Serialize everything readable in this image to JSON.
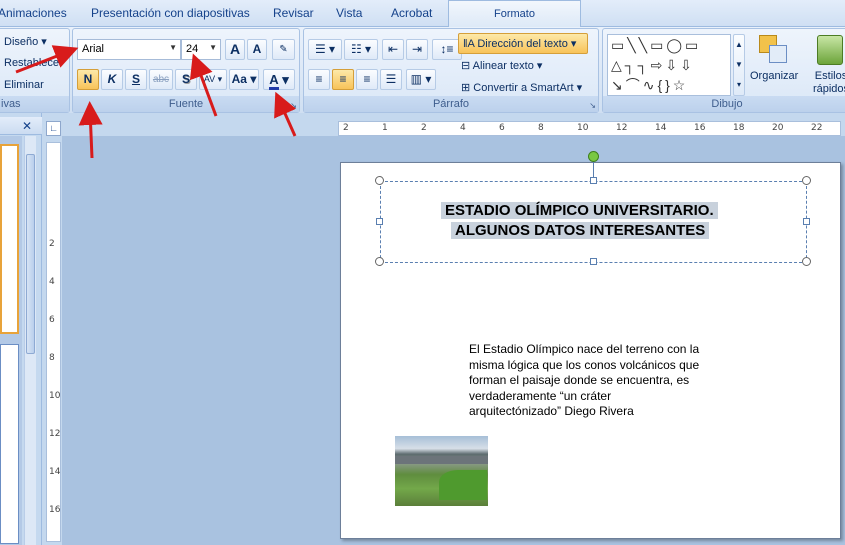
{
  "tabs": [
    "Animaciones",
    "Presentación con diapositivas",
    "Revisar",
    "Vista",
    "Acrobat",
    "Formato"
  ],
  "diapositivas_group": {
    "items": [
      "Diseño",
      "Restablecer",
      "Eliminar"
    ],
    "label_partial": "ivas"
  },
  "fuente_group": {
    "font_name": "Arial",
    "font_size": "24",
    "bold": "N",
    "italic": "K",
    "underline": "S",
    "strike": "abc",
    "shadow": "S",
    "spacing": "AV",
    "case": "Aa",
    "color": "A",
    "grow": "A",
    "shrink": "A",
    "label": "Fuente",
    "color_bar": "#1f3aa8"
  },
  "parrafo_group": {
    "text_direction": "Dirección del texto",
    "align_text": "Alinear texto",
    "smartart": "Convertir a SmartArt",
    "label": "Párrafo"
  },
  "dibujo_group": {
    "arrange": "Organizar",
    "styles": "Estilos rápidos",
    "label": "Dibujo"
  },
  "ruler_numbers": [
    "2",
    "1",
    "2",
    "4",
    "6",
    "8",
    "10",
    "12",
    "14",
    "16",
    "18",
    "20",
    "22"
  ],
  "vruler_numbers": [
    "2",
    "4",
    "6",
    "8",
    "10",
    "12",
    "14",
    "16"
  ],
  "slide": {
    "title_line1": "ESTADIO OLÍMPICO UNIVERSITARIO.",
    "title_line2": "ALGUNOS DATOS INTERESANTES",
    "body_lines": [
      "El Estadio Olímpico nace del terreno con la",
      "misma lógica que los conos volcánicos que",
      "forman el paisaje donde se encuentra,  es",
      "verdaderamente “un cráter",
      "arquitectónizado”   Diego Rivera"
    ]
  },
  "annotation_color": "#d81b1b",
  "icons": [
    "bullets-icon",
    "numbering-icon",
    "indent-icon",
    "line-spacing-icon",
    "align-left-icon",
    "center-icon",
    "align-right-icon",
    "justify-icon",
    "columns-icon",
    "shapes-gallery-icon",
    "arrange-icon",
    "quick-styles-icon"
  ]
}
